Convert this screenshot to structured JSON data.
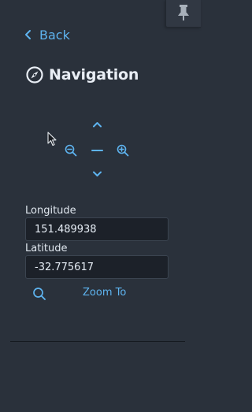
{
  "header": {
    "back_label": "Back",
    "title": "Navigation"
  },
  "icons": {
    "pin": "pin-icon",
    "back": "chevron-left-icon",
    "title": "compass-icon",
    "pan_up": "chevron-up-icon",
    "pan_down": "chevron-down-icon",
    "zoom_out": "zoom-out-icon",
    "zoom_in": "zoom-in-icon",
    "reset": "dash-icon",
    "search": "search-icon"
  },
  "coordinates": {
    "longitude_label": "Longitude",
    "longitude_value": "151.489938",
    "latitude_label": "Latitude",
    "latitude_value": "-32.775617",
    "zoom_to_label": "Zoom To"
  },
  "colors": {
    "background": "#2a313b",
    "accent": "#5eb4f0",
    "input_background": "#1c2129",
    "text": "#e6edf5"
  }
}
